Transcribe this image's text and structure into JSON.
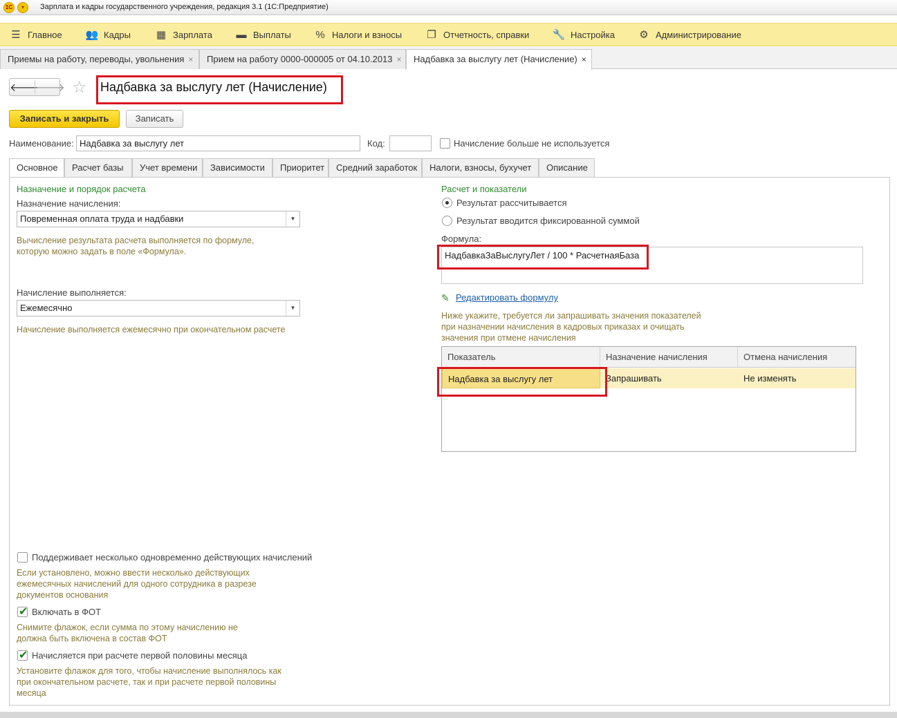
{
  "window": {
    "title": "Зарплата и кадры государственного учреждения, редакция 3.1  (1С:Предприятие)",
    "logo_text": "1С"
  },
  "sections": [
    {
      "label": "Главное",
      "icon": "hamburger-menu-icon"
    },
    {
      "label": "Кадры",
      "icon": "people-icon"
    },
    {
      "label": "Зарплата",
      "icon": "calculator-icon"
    },
    {
      "label": "Выплаты",
      "icon": "wallet-icon"
    },
    {
      "label": "Налоги и взносы",
      "icon": "percent-icon"
    },
    {
      "label": "Отчетность, справки",
      "icon": "documents-icon"
    },
    {
      "label": "Настройка",
      "icon": "wrench-icon"
    },
    {
      "label": "Администрирование",
      "icon": "gear-icon"
    }
  ],
  "open_tabs": [
    {
      "label": "Приемы на работу, переводы, увольнения",
      "close": "×"
    },
    {
      "label": "Прием на работу 0000-000005 от 04.10.2013",
      "close": "×"
    },
    {
      "label": "Надбавка за выслугу лет (Начисление)",
      "close": "×"
    }
  ],
  "form": {
    "title": "Надбавка за выслугу лет (Начисление)",
    "save_close_label": "Записать и закрыть",
    "save_label": "Записать",
    "name_label": "Наименование:",
    "name_value": "Надбавка за выслугу лет",
    "code_label": "Код:",
    "code_value": "",
    "not_used_label": "Начисление больше не используется"
  },
  "form_tabs": [
    "Основное",
    "Расчет базы",
    "Учет времени",
    "Зависимости",
    "Приоритет",
    "Средний заработок",
    "Налоги, взносы, бухучет",
    "Описание"
  ],
  "left": {
    "group_title": "Назначение и порядок расчета",
    "purpose_label": "Назначение начисления:",
    "purpose_value": "Повременная оплата труда и надбавки",
    "purpose_hint_1": "Вычисление результата расчета выполняется по формуле,",
    "purpose_hint_2": "которую можно задать в поле «Формула».",
    "period_label": "Начисление выполняется:",
    "period_value": "Ежемесячно",
    "period_hint": "Начисление выполняется ежемесячно при окончательном расчете",
    "multi_label": "Поддерживает несколько одновременно действующих начислений",
    "multi_hint_1": "Если установлено, можно ввести несколько действующих",
    "multi_hint_2": "ежемесячных начислений для одного сотрудника в разрезе",
    "multi_hint_3": "документов основания",
    "fot_label": "Включать в ФОТ",
    "fot_hint_1": "Снимите флажок, если сумма по этому начислению не",
    "fot_hint_2": "должна быть включена в состав ФОТ",
    "half_label": "Начисляется при расчете первой половины месяца",
    "half_hint_1": "Установите флажок для того, чтобы начисление выполнялось как",
    "half_hint_2": "при окончательном расчете, так и при расчете первой половины",
    "half_hint_3": "месяца"
  },
  "right": {
    "group_title": "Расчет и показатели",
    "radio_calc": "Результат рассчитывается",
    "radio_fixed": "Результат вводится фиксированной суммой",
    "formula_label": "Формула:",
    "formula_value": "НадбавкаЗаВыслугуЛет / 100 * РасчетнаяБаза",
    "edit_formula": "Редактировать формулу",
    "note_1": "Ниже укажите, требуется ли запрашивать значения показателей",
    "note_2": "при назначении начисления в кадровых приказах и очищать",
    "note_3": "значения при отмене начисления",
    "table": {
      "columns": [
        "Показатель",
        "Назначение начисления",
        "Отмена начисления"
      ],
      "rows": [
        [
          "Надбавка за выслугу лет",
          "Запрашивать",
          "Не изменять"
        ]
      ]
    }
  },
  "colors": {
    "section_bar": "#fbed9e",
    "primary_button": "#f2c600",
    "group_title": "#2d8a2d",
    "hint_text": "#8b7a3a",
    "highlight_frame": "#d8151f",
    "selected_row": "#fbf1c3"
  }
}
